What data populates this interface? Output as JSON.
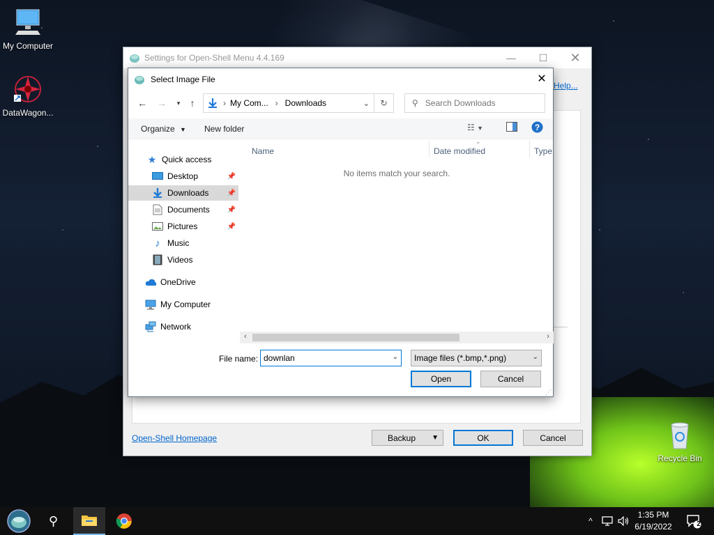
{
  "desktop": {
    "icons": [
      {
        "label": "My Computer"
      },
      {
        "label": "DataWagon..."
      },
      {
        "label": "Recycle Bin"
      }
    ]
  },
  "settings_window": {
    "title": "Settings for Open-Shell Menu 4.4.169",
    "help_link": "Help...",
    "homepage_link": "Open-Shell Homepage",
    "backup_label": "Backup",
    "ok_label": "OK",
    "cancel_label": "Cancel"
  },
  "dialog": {
    "title": "Select Image File",
    "breadcrumb": [
      "My Com...",
      "Downloads"
    ],
    "search_placeholder": "Search Downloads",
    "commands": {
      "organize": "Organize",
      "new_folder": "New folder"
    },
    "nav": [
      {
        "label": "Quick access"
      },
      {
        "label": "Desktop"
      },
      {
        "label": "Downloads"
      },
      {
        "label": "Documents"
      },
      {
        "label": "Pictures"
      },
      {
        "label": "Music"
      },
      {
        "label": "Videos"
      },
      {
        "label": "OneDrive"
      },
      {
        "label": "My Computer"
      },
      {
        "label": "Network"
      }
    ],
    "columns": [
      "Name",
      "Date modified",
      "Type"
    ],
    "empty_message": "No items match your search.",
    "file_name_label": "File name:",
    "file_name_value": "downlan",
    "file_type": "Image files (*.bmp,*.png)",
    "open_label": "Open",
    "cancel_label": "Cancel"
  },
  "taskbar": {
    "time": "1:35 PM",
    "date": "6/19/2022",
    "notifications": "2"
  }
}
